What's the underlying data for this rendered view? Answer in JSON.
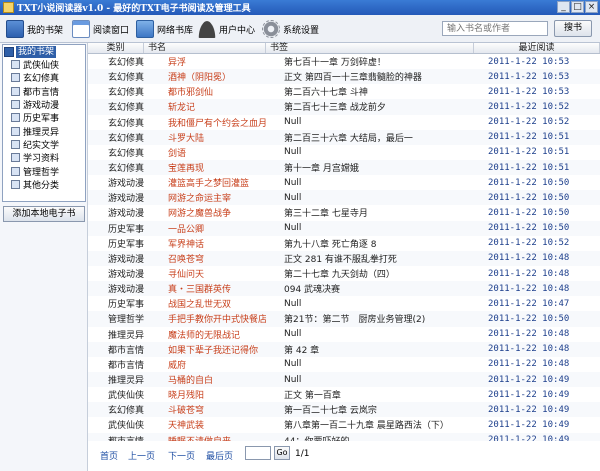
{
  "window": {
    "title": "TXT小说阅读器v1.0 - 最好的TXT电子书阅读及管理工具",
    "buttons": [
      "_",
      "□",
      "×"
    ]
  },
  "toolbar": {
    "my_shelf": "我的书架",
    "read_window": "阅读窗口",
    "online_library": "网络书库",
    "user_center": "用户中心",
    "settings": "系统设置",
    "search_placeholder": "输入书名或作者",
    "search_label": "搜书"
  },
  "sidebar": {
    "root_label": "我的书架",
    "items": [
      {
        "label": "武侠仙侠",
        "icon": "book-icon"
      },
      {
        "label": "玄幻修真",
        "icon": "book-icon"
      },
      {
        "label": "都市言情",
        "icon": "book-icon"
      },
      {
        "label": "游戏动漫",
        "icon": "book-icon"
      },
      {
        "label": "历史军事",
        "icon": "book-icon"
      },
      {
        "label": "推理灵异",
        "icon": "book-icon"
      },
      {
        "label": "纪实文学",
        "icon": "book-icon"
      },
      {
        "label": "学习资料",
        "icon": "book-icon"
      },
      {
        "label": "管理哲学",
        "icon": "book-icon"
      },
      {
        "label": "其他分类",
        "icon": "book-icon"
      }
    ],
    "add_button": "添加本地电子书"
  },
  "table": {
    "headers": {
      "category": "类别",
      "book": "书名",
      "chapter": "书签",
      "last_read": "最近阅读"
    },
    "rows": [
      {
        "category": "玄幻修真",
        "book": "异浮",
        "chapter": "第七百十一章 万剑碎虚！",
        "date": "2011-1-22 10:53"
      },
      {
        "category": "玄幻修真",
        "book": "酒神（阴阳冕）",
        "chapter": "正文 第四百一十三章翡髓脸的神器",
        "date": "2011-1-22 10:53"
      },
      {
        "category": "玄幻修真",
        "book": "都市邪剑仙",
        "chapter": "第二百六十七章 斗神",
        "date": "2011-1-22 10:53"
      },
      {
        "category": "玄幻修真",
        "book": "斩龙记",
        "chapter": "第二百七十三章 战龙前夕",
        "date": "2011-1-22 10:52"
      },
      {
        "category": "玄幻修真",
        "book": "我和僵尸有个约会之血月",
        "chapter": "Null",
        "date": "2011-1-22 10:52"
      },
      {
        "category": "玄幻修真",
        "book": "斗罗大陆",
        "chapter": "第二百三十六章 大结局，最后一",
        "date": "2011-1-22 10:51"
      },
      {
        "category": "玄幻修真",
        "book": "剑语",
        "chapter": "Null",
        "date": "2011-1-22 10:51"
      },
      {
        "category": "玄幻修真",
        "book": "宝莲再现",
        "chapter": "第十一章 月宫嫦娥",
        "date": "2011-1-22 10:51"
      },
      {
        "category": "游戏动漫",
        "book": "灌篮高手之梦回灌篮",
        "chapter": "Null",
        "date": "2011-1-22 10:50"
      },
      {
        "category": "游戏动漫",
        "book": "网游之命运主宰",
        "chapter": "Null",
        "date": "2011-1-22 10:50"
      },
      {
        "category": "游戏动漫",
        "book": "网游之魔兽战争",
        "chapter": "第三十二章 七星寺月",
        "date": "2011-1-22 10:50"
      },
      {
        "category": "历史军事",
        "book": "一品公卿",
        "chapter": "Null",
        "date": "2011-1-22 10:50"
      },
      {
        "category": "历史军事",
        "book": "军界神话",
        "chapter": "第九十八章 死亡角逐 8",
        "date": "2011-1-22 10:52"
      },
      {
        "category": "游戏动漫",
        "book": "召唤苍穹",
        "chapter": "正文 281 有谁不服乱拳打死",
        "date": "2011-1-22 10:48"
      },
      {
        "category": "游戏动漫",
        "book": "寻仙问天",
        "chapter": "第二十七章 九天剑劫（四）",
        "date": "2011-1-22 10:48"
      },
      {
        "category": "游戏动漫",
        "book": "真・三国群英传",
        "chapter": "094 武魂决赛",
        "date": "2011-1-22 10:48"
      },
      {
        "category": "历史军事",
        "book": "战国之乱世无双",
        "chapter": "Null",
        "date": "2011-1-22 10:47"
      },
      {
        "category": "管理哲学",
        "book": "手把手教你开中式快餐店",
        "chapter": "第21节：第二节　厨房业务管理(2)",
        "date": "2011-1-22 10:50"
      },
      {
        "category": "推理灵异",
        "book": "魔法师的无限战记",
        "chapter": "Null",
        "date": "2011-1-22 10:48"
      },
      {
        "category": "都市言情",
        "book": "如果下辈子我还记得你",
        "chapter": "第 42 章",
        "date": "2011-1-22 10:48"
      },
      {
        "category": "都市言情",
        "book": "威府",
        "chapter": "Null",
        "date": "2011-1-22 10:48"
      },
      {
        "category": "推理灵异",
        "book": "马桶的自白",
        "chapter": "Null",
        "date": "2011-1-22 10:49"
      },
      {
        "category": "武侠仙侠",
        "book": "晓月残阳",
        "chapter": "正文 第一百章",
        "date": "2011-1-22 10:49"
      },
      {
        "category": "玄幻修真",
        "book": "斗破苍穹",
        "chapter": "第一百二十七章 云岚宗",
        "date": "2011-1-22 10:49"
      },
      {
        "category": "武侠仙侠",
        "book": "天神武装",
        "chapter": "第八章第一百二十九章 晨星路西法（下）",
        "date": "2011-1-22 10:49"
      },
      {
        "category": "都市言情",
        "book": "睡眠不请做自来",
        "chapter": "44：你要吓好的",
        "date": "2011-1-22 10:49"
      }
    ]
  },
  "pager": {
    "first": "首页",
    "prev": "上一页",
    "next": "下一页",
    "last": "最后页",
    "page_input": "",
    "go": "Go",
    "count": "1/1"
  }
}
